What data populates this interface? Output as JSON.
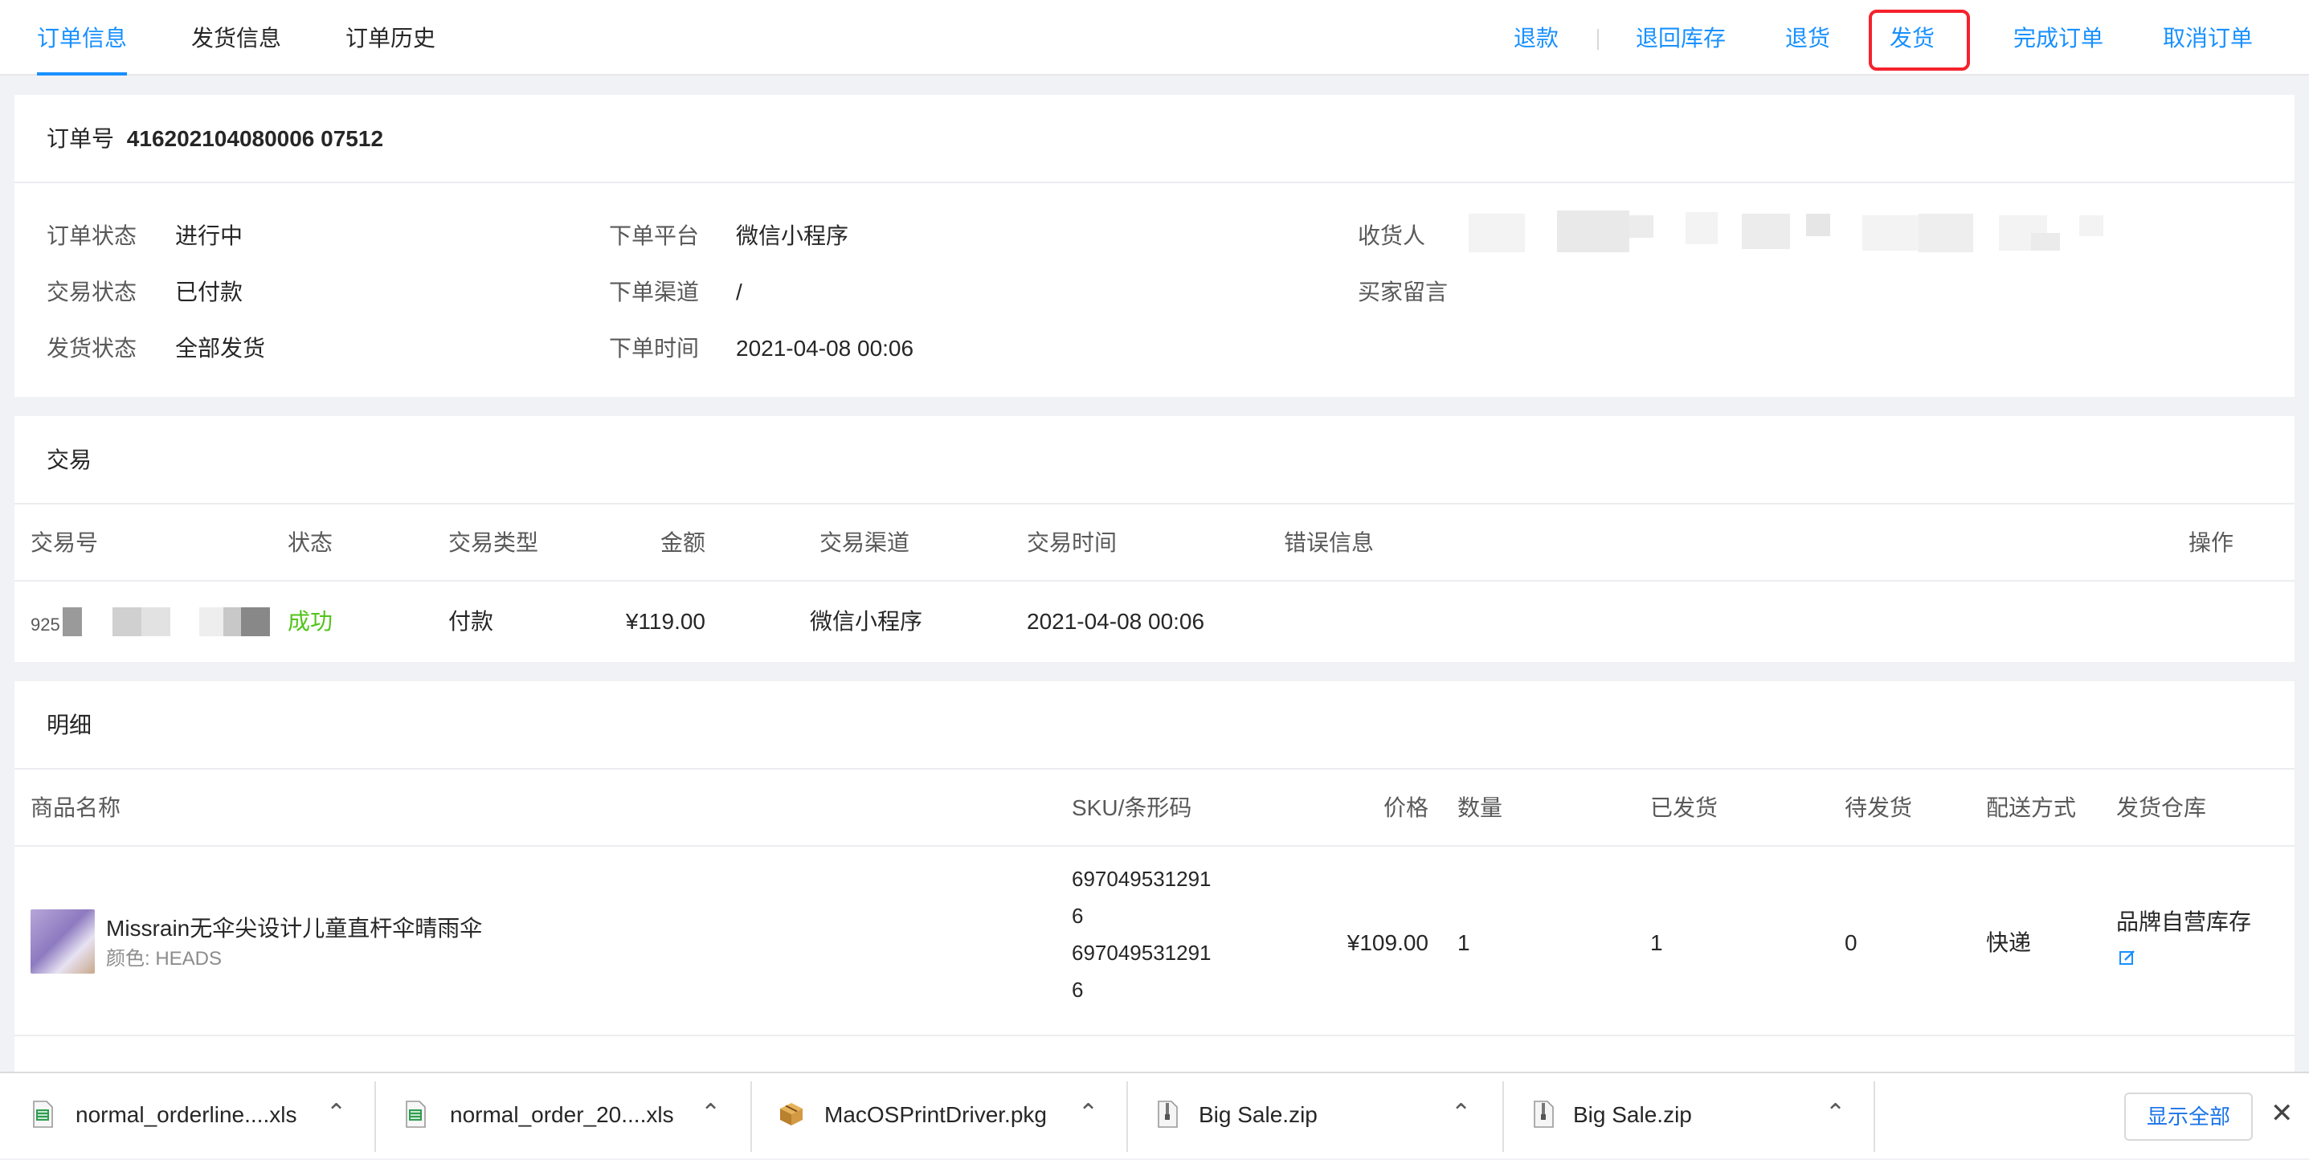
{
  "tabs": [
    {
      "label": "订单信息",
      "active": true
    },
    {
      "label": "发货信息",
      "active": false
    },
    {
      "label": "订单历史",
      "active": false
    }
  ],
  "actions": {
    "refund": "退款",
    "return_stock": "退回库存",
    "return_goods": "退货",
    "ship": "发货",
    "complete": "完成订单",
    "cancel": "取消订单"
  },
  "order": {
    "number_label": "订单号",
    "number": "416202104080006 07512",
    "fields": {
      "status_label": "订单状态",
      "status": "进行中",
      "trade_status_label": "交易状态",
      "trade_status": "已付款",
      "ship_status_label": "发货状态",
      "ship_status": "全部发货",
      "platform_label": "下单平台",
      "platform": "微信小程序",
      "channel_label": "下单渠道",
      "channel": "/",
      "time_label": "下单时间",
      "time": "2021-04-08 00:06",
      "receiver_label": "收货人",
      "buyer_note_label": "买家留言"
    }
  },
  "trade": {
    "title": "交易",
    "headers": [
      "交易号",
      "状态",
      "交易类型",
      "金额",
      "交易渠道",
      "交易时间",
      "错误信息",
      "操作"
    ],
    "row": {
      "id_prefix": "925",
      "status": "成功",
      "type": "付款",
      "amount": "¥119.00",
      "channel": "微信小程序",
      "time": "2021-04-08 00:06",
      "error": ""
    }
  },
  "detail": {
    "title": "明细",
    "headers": [
      "商品名称",
      "SKU/条形码",
      "价格",
      "数量",
      "已发货",
      "待发货",
      "配送方式",
      "发货仓库"
    ],
    "row": {
      "name": "Missrain无伞尖设计儿童直杆伞晴雨伞",
      "variant": "颜色: HEADS",
      "sku_line1": "697049531291",
      "sku_line2": "6",
      "barcode_line1": "697049531291",
      "barcode_line2": "6",
      "price": "¥109.00",
      "qty": "1",
      "shipped": "1",
      "pending": "0",
      "delivery": "快递",
      "warehouse": "品牌自营库存"
    }
  },
  "downloads": {
    "items": [
      {
        "name": "normal_orderline....xls",
        "icon": "spreadsheet-file-icon"
      },
      {
        "name": "normal_order_20....xls",
        "icon": "spreadsheet-file-icon"
      },
      {
        "name": "MacOSPrintDriver.pkg",
        "icon": "package-file-icon"
      },
      {
        "name": "Big Sale.zip",
        "icon": "zip-file-icon"
      },
      {
        "name": "Big Sale.zip",
        "icon": "zip-file-icon"
      }
    ],
    "show_all": "显示全部"
  },
  "colors": {
    "primary": "#1890ff",
    "success": "#52c41a",
    "highlight": "#f5222d"
  }
}
